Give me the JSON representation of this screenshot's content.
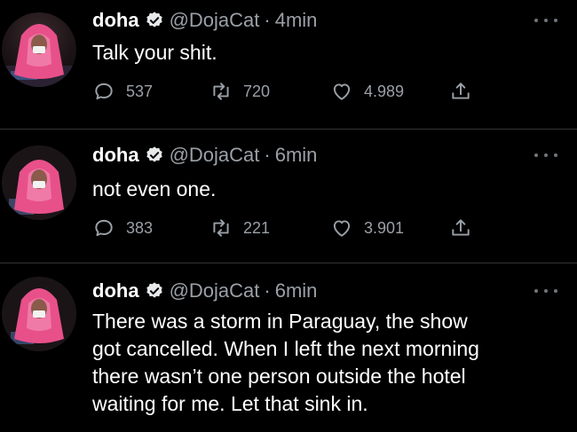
{
  "tweets": [
    {
      "name": "doha",
      "handle": "@DojaCat",
      "separator": "·",
      "time": "4min",
      "text": "Talk your shit.",
      "replies": "537",
      "retweets": "720",
      "likes": "4.989"
    },
    {
      "name": "doha",
      "handle": "@DojaCat",
      "separator": "·",
      "time": "6min",
      "text": "not even one.",
      "replies": "383",
      "retweets": "221",
      "likes": "3.901"
    },
    {
      "name": "doha",
      "handle": "@DojaCat",
      "separator": "·",
      "time": "6min",
      "text_lines": [
        "There was a storm in Paraguay, the show",
        "got cancelled. When I left the next morning",
        "there wasn’t one person outside the hotel",
        "waiting for me. Let that sink in."
      ]
    }
  ],
  "colors": {
    "background": "#000000",
    "text": "#ffffff",
    "muted": "#9aa0a6",
    "verified_badge": "#e7e9ea",
    "divider": "#2f3336",
    "avatar_accent": "#e8508a"
  },
  "icons": {
    "verified": "verified-badge-icon",
    "reply": "reply-bubble-icon",
    "retweet": "retweet-arrows-icon",
    "like": "heart-icon",
    "share": "share-upload-icon",
    "more": "more-dots-icon"
  }
}
